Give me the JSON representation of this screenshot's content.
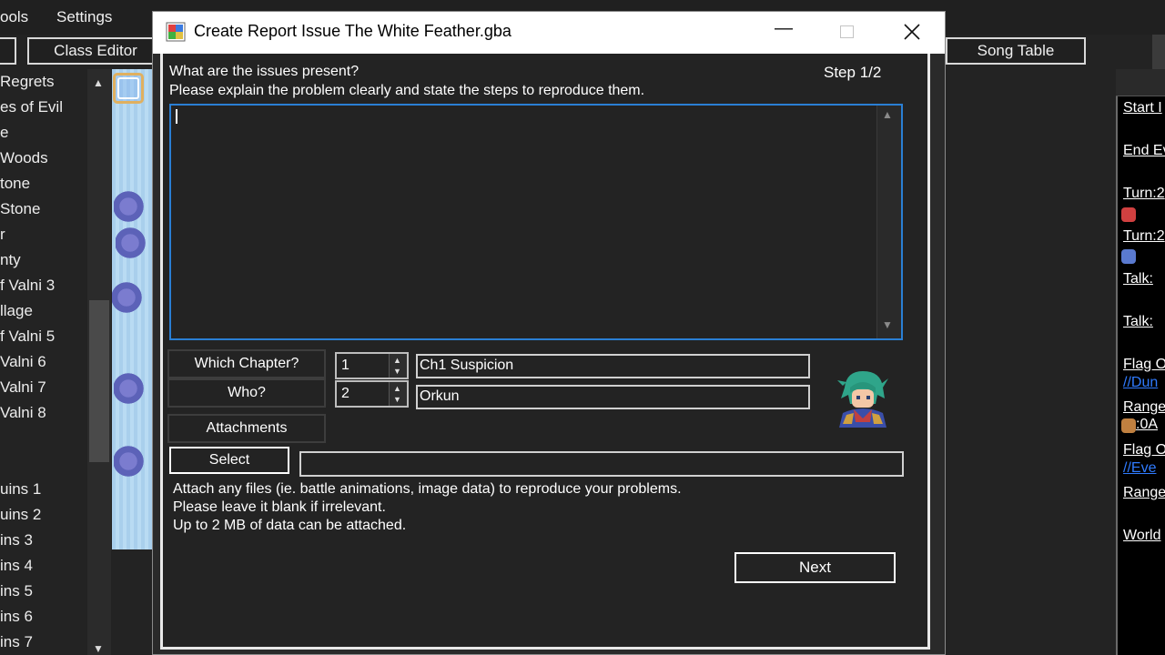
{
  "app": {
    "menu": [
      "ools",
      "Settings"
    ],
    "toolbar": {
      "class_editor": "Class Editor",
      "song_table": "Song Table"
    },
    "left_list": [
      "Regrets",
      "es of Evil",
      "e",
      "Woods",
      "tone",
      "Stone",
      "r",
      "nty",
      "f Valni 3",
      "llage",
      "f Valni 5",
      "Valni 6",
      "Valni 7",
      "Valni 8",
      "uins 1",
      "uins 2",
      "ins 3",
      "ins 4",
      "ins 5",
      "ins 6",
      "ins 7"
    ],
    "right_panel": [
      "Start I",
      "End Ev",
      "Turn:2",
      "Turn:2",
      "Talk:",
      "Talk:",
      "Flag O",
      "//Dun",
      "Range",
      ":0A",
      "Flag O",
      "//Eve",
      "Range",
      "World"
    ]
  },
  "dialog": {
    "title": "Create Report Issue The White Feather.gba",
    "question": "What are the issues present?",
    "instruction": "Please explain the problem clearly and state the steps to reproduce them.",
    "step": "Step 1/2",
    "issue_text": "",
    "chapter_label": "Which Chapter?",
    "chapter_value": "1",
    "chapter_name": "Ch1 Suspicion",
    "who_label": "Who?",
    "who_value": "2",
    "who_name": "Orkun",
    "attachments_label": "Attachments",
    "select_label": "Select",
    "attach_path": "",
    "attach_help_1": "Attach any files (ie. battle animations, image data) to reproduce your problems.",
    "attach_help_2": "Please leave it blank if irrelevant.",
    "attach_help_3": "Up to 2 MB of data can be attached.",
    "next_label": "Next"
  },
  "colors": {
    "background": "#232323",
    "focus_border": "#2a7fd4",
    "link_blue": "#2f7bff",
    "titlebar": "#ffffff"
  }
}
